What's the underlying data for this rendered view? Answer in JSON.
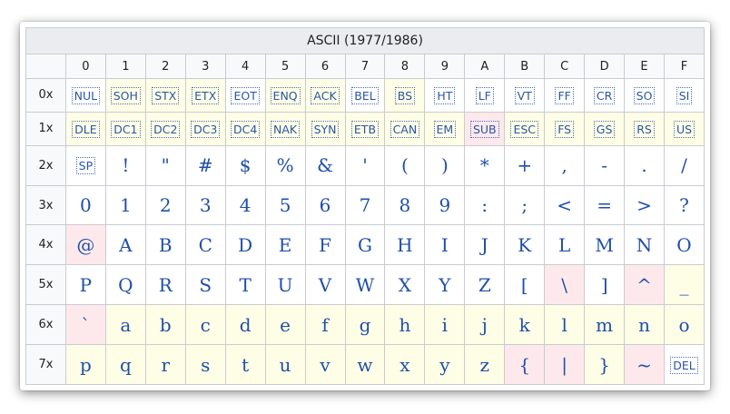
{
  "title": "ASCII (1977/1986)",
  "columns": [
    "0",
    "1",
    "2",
    "3",
    "4",
    "5",
    "6",
    "7",
    "8",
    "9",
    "A",
    "B",
    "C",
    "D",
    "E",
    "F"
  ],
  "rows": [
    {
      "label": "0x",
      "cells": [
        {
          "c": "NUL",
          "ctrl": true,
          "bg": "w"
        },
        {
          "c": "SOH",
          "ctrl": true,
          "bg": "y"
        },
        {
          "c": "STX",
          "ctrl": true,
          "bg": "y"
        },
        {
          "c": "ETX",
          "ctrl": true,
          "bg": "y"
        },
        {
          "c": "EOT",
          "ctrl": true,
          "bg": "w"
        },
        {
          "c": "ENQ",
          "ctrl": true,
          "bg": "y"
        },
        {
          "c": "ACK",
          "ctrl": true,
          "bg": "y"
        },
        {
          "c": "BEL",
          "ctrl": true,
          "bg": "w"
        },
        {
          "c": "BS",
          "ctrl": true,
          "bg": "y"
        },
        {
          "c": "HT",
          "ctrl": true,
          "bg": "w"
        },
        {
          "c": "LF",
          "ctrl": true,
          "bg": "w"
        },
        {
          "c": "VT",
          "ctrl": true,
          "bg": "w"
        },
        {
          "c": "FF",
          "ctrl": true,
          "bg": "w"
        },
        {
          "c": "CR",
          "ctrl": true,
          "bg": "w"
        },
        {
          "c": "SO",
          "ctrl": true,
          "bg": "w"
        },
        {
          "c": "SI",
          "ctrl": true,
          "bg": "w"
        }
      ]
    },
    {
      "label": "1x",
      "cells": [
        {
          "c": "DLE",
          "ctrl": true,
          "bg": "y"
        },
        {
          "c": "DC1",
          "ctrl": true,
          "bg": "y"
        },
        {
          "c": "DC2",
          "ctrl": true,
          "bg": "y"
        },
        {
          "c": "DC3",
          "ctrl": true,
          "bg": "y"
        },
        {
          "c": "DC4",
          "ctrl": true,
          "bg": "y"
        },
        {
          "c": "NAK",
          "ctrl": true,
          "bg": "y"
        },
        {
          "c": "SYN",
          "ctrl": true,
          "bg": "y"
        },
        {
          "c": "ETB",
          "ctrl": true,
          "bg": "y"
        },
        {
          "c": "CAN",
          "ctrl": true,
          "bg": "y"
        },
        {
          "c": "EM",
          "ctrl": true,
          "bg": "y"
        },
        {
          "c": "SUB",
          "ctrl": true,
          "bg": "p"
        },
        {
          "c": "ESC",
          "ctrl": true,
          "bg": "y"
        },
        {
          "c": "FS",
          "ctrl": true,
          "bg": "y"
        },
        {
          "c": "GS",
          "ctrl": true,
          "bg": "y"
        },
        {
          "c": "RS",
          "ctrl": true,
          "bg": "y"
        },
        {
          "c": "US",
          "ctrl": true,
          "bg": "y"
        }
      ]
    },
    {
      "label": "2x",
      "cells": [
        {
          "c": "SP",
          "ctrl": true,
          "bg": "w"
        },
        {
          "c": "!",
          "bg": "w"
        },
        {
          "c": "\"",
          "bg": "w"
        },
        {
          "c": "#",
          "bg": "w"
        },
        {
          "c": "$",
          "bg": "w"
        },
        {
          "c": "%",
          "bg": "w"
        },
        {
          "c": "&",
          "bg": "w"
        },
        {
          "c": "'",
          "bg": "w"
        },
        {
          "c": "(",
          "bg": "w"
        },
        {
          "c": ")",
          "bg": "w"
        },
        {
          "c": "*",
          "bg": "w"
        },
        {
          "c": "+",
          "bg": "w"
        },
        {
          "c": ",",
          "bg": "w"
        },
        {
          "c": "-",
          "bg": "w"
        },
        {
          "c": ".",
          "bg": "w"
        },
        {
          "c": "/",
          "bg": "w"
        }
      ]
    },
    {
      "label": "3x",
      "cells": [
        {
          "c": "0",
          "bg": "w"
        },
        {
          "c": "1",
          "bg": "w"
        },
        {
          "c": "2",
          "bg": "w"
        },
        {
          "c": "3",
          "bg": "w"
        },
        {
          "c": "4",
          "bg": "w"
        },
        {
          "c": "5",
          "bg": "w"
        },
        {
          "c": "6",
          "bg": "w"
        },
        {
          "c": "7",
          "bg": "w"
        },
        {
          "c": "8",
          "bg": "w"
        },
        {
          "c": "9",
          "bg": "w"
        },
        {
          "c": ":",
          "bg": "w"
        },
        {
          "c": ";",
          "bg": "w"
        },
        {
          "c": "<",
          "bg": "w"
        },
        {
          "c": "=",
          "bg": "w"
        },
        {
          "c": ">",
          "bg": "w"
        },
        {
          "c": "?",
          "bg": "w"
        }
      ]
    },
    {
      "label": "4x",
      "cells": [
        {
          "c": "@",
          "bg": "p"
        },
        {
          "c": "A",
          "bg": "w"
        },
        {
          "c": "B",
          "bg": "w"
        },
        {
          "c": "C",
          "bg": "w"
        },
        {
          "c": "D",
          "bg": "w"
        },
        {
          "c": "E",
          "bg": "w"
        },
        {
          "c": "F",
          "bg": "w"
        },
        {
          "c": "G",
          "bg": "w"
        },
        {
          "c": "H",
          "bg": "w"
        },
        {
          "c": "I",
          "bg": "w"
        },
        {
          "c": "J",
          "bg": "w"
        },
        {
          "c": "K",
          "bg": "w"
        },
        {
          "c": "L",
          "bg": "w"
        },
        {
          "c": "M",
          "bg": "w"
        },
        {
          "c": "N",
          "bg": "w"
        },
        {
          "c": "O",
          "bg": "w"
        }
      ]
    },
    {
      "label": "5x",
      "cells": [
        {
          "c": "P",
          "bg": "w"
        },
        {
          "c": "Q",
          "bg": "w"
        },
        {
          "c": "R",
          "bg": "w"
        },
        {
          "c": "S",
          "bg": "w"
        },
        {
          "c": "T",
          "bg": "w"
        },
        {
          "c": "U",
          "bg": "w"
        },
        {
          "c": "V",
          "bg": "w"
        },
        {
          "c": "W",
          "bg": "w"
        },
        {
          "c": "X",
          "bg": "w"
        },
        {
          "c": "Y",
          "bg": "w"
        },
        {
          "c": "Z",
          "bg": "w"
        },
        {
          "c": "[",
          "bg": "w"
        },
        {
          "c": "\\",
          "bg": "p"
        },
        {
          "c": "]",
          "bg": "w"
        },
        {
          "c": "^",
          "bg": "p"
        },
        {
          "c": "_",
          "bg": "y"
        }
      ]
    },
    {
      "label": "6x",
      "cells": [
        {
          "c": "`",
          "bg": "p"
        },
        {
          "c": "a",
          "bg": "y"
        },
        {
          "c": "b",
          "bg": "y"
        },
        {
          "c": "c",
          "bg": "y"
        },
        {
          "c": "d",
          "bg": "y"
        },
        {
          "c": "e",
          "bg": "y"
        },
        {
          "c": "f",
          "bg": "y"
        },
        {
          "c": "g",
          "bg": "y"
        },
        {
          "c": "h",
          "bg": "y"
        },
        {
          "c": "i",
          "bg": "y"
        },
        {
          "c": "j",
          "bg": "y"
        },
        {
          "c": "k",
          "bg": "y"
        },
        {
          "c": "l",
          "bg": "y"
        },
        {
          "c": "m",
          "bg": "y"
        },
        {
          "c": "n",
          "bg": "y"
        },
        {
          "c": "o",
          "bg": "y"
        }
      ]
    },
    {
      "label": "7x",
      "cells": [
        {
          "c": "p",
          "bg": "y"
        },
        {
          "c": "q",
          "bg": "y"
        },
        {
          "c": "r",
          "bg": "y"
        },
        {
          "c": "s",
          "bg": "y"
        },
        {
          "c": "t",
          "bg": "y"
        },
        {
          "c": "u",
          "bg": "y"
        },
        {
          "c": "v",
          "bg": "y"
        },
        {
          "c": "w",
          "bg": "y"
        },
        {
          "c": "x",
          "bg": "y"
        },
        {
          "c": "y",
          "bg": "y"
        },
        {
          "c": "z",
          "bg": "y"
        },
        {
          "c": "{",
          "bg": "p"
        },
        {
          "c": "|",
          "bg": "p"
        },
        {
          "c": "}",
          "bg": "y"
        },
        {
          "c": "~",
          "bg": "p"
        },
        {
          "c": "DEL",
          "ctrl": true,
          "bg": "w"
        }
      ]
    }
  ],
  "colors": {
    "yellow_bg": "#fefee6",
    "pink_bg": "#fde9ec",
    "char_color": "#1f4fa8",
    "border": "#c8ccd1"
  }
}
